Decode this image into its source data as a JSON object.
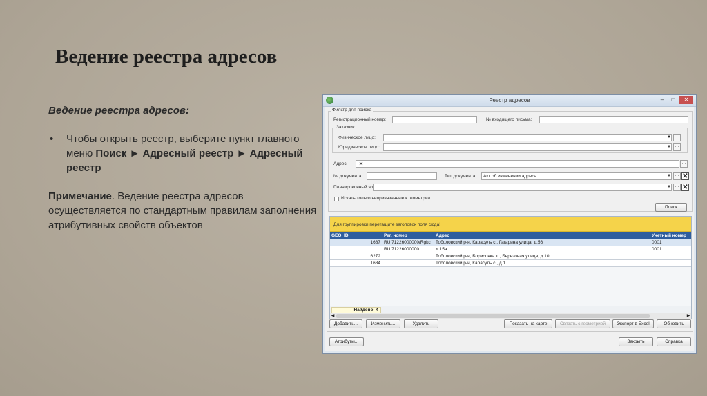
{
  "slide": {
    "title": "Ведение реестра адресов",
    "subheading": "Ведение реестра адресов:",
    "bullet_prefix": "Чтобы открыть реестр, выберите пункт главного меню ",
    "bullet_path": "Поиск ► Адресный реестр ► Адресный реестр",
    "note_label": "Примечание",
    "note_text": ". Ведение реестра адресов осуществляется по стандартным правилам заполнения атрибутивных свойств объектов"
  },
  "window": {
    "title": "Реестр адресов",
    "controls": {
      "minimize": "–",
      "maximize": "□",
      "close": "✕"
    }
  },
  "filter": {
    "legend": "Фильтр для поиска",
    "reg_number_label": "Регистрационный номер:",
    "reg_number_value": "",
    "incoming_letter_label": "№ входящего письма:",
    "incoming_letter_value": "",
    "customer_legend": "Заказчик",
    "individual_label": "Физическое лицо:",
    "legal_entity_label": "Юридическое лицо:",
    "address_label": "Адрес:",
    "doc_number_label": "№ документа:",
    "doc_type_label": "Тип документа:",
    "doc_type_value": "Акт об изменении адреса",
    "planning_element_label": "Планировочный элемент:",
    "unbound_checkbox_label": "Искать только непривязанные к геометрии",
    "search_button": "Поиск"
  },
  "grid": {
    "group_hint": "Для группировки перетащите заголовок поля сюда!",
    "columns": [
      "GEO_ID",
      "Рег. номер",
      "Адрес",
      "Учетный номер"
    ],
    "rows": [
      [
        "1687",
        "RU 71226000000/Rgkc",
        "Тоболовский р-н, Карасуль с., Гагарина улица, д.56",
        "0001"
      ],
      [
        "",
        "RU 71226000000",
        "д.15а",
        "0001"
      ],
      [
        "6272",
        "",
        "Тоболовский р-н, Борисовка д., Березовая улица, д.10",
        ""
      ],
      [
        "1634",
        "",
        "Тоболовский р-н, Карасуль с., д.1",
        ""
      ]
    ],
    "found_label": "Найдено: 4"
  },
  "actions": {
    "add": "Добавить...",
    "edit": "Изменить...",
    "delete": "Удалить",
    "show_on_map": "Показать на карте",
    "link_geometry": "Связать с геометрией",
    "export_excel": "Экспорт в Excel",
    "refresh": "Обновить",
    "attributes": "Атрибуты...",
    "close": "Закрыть",
    "help": "Справка"
  },
  "colors": {
    "background": "#b3ab9d",
    "group_bar": "#f5d34a",
    "grid_header": "#2f5e9e",
    "selected_row": "#d9e5f3"
  }
}
